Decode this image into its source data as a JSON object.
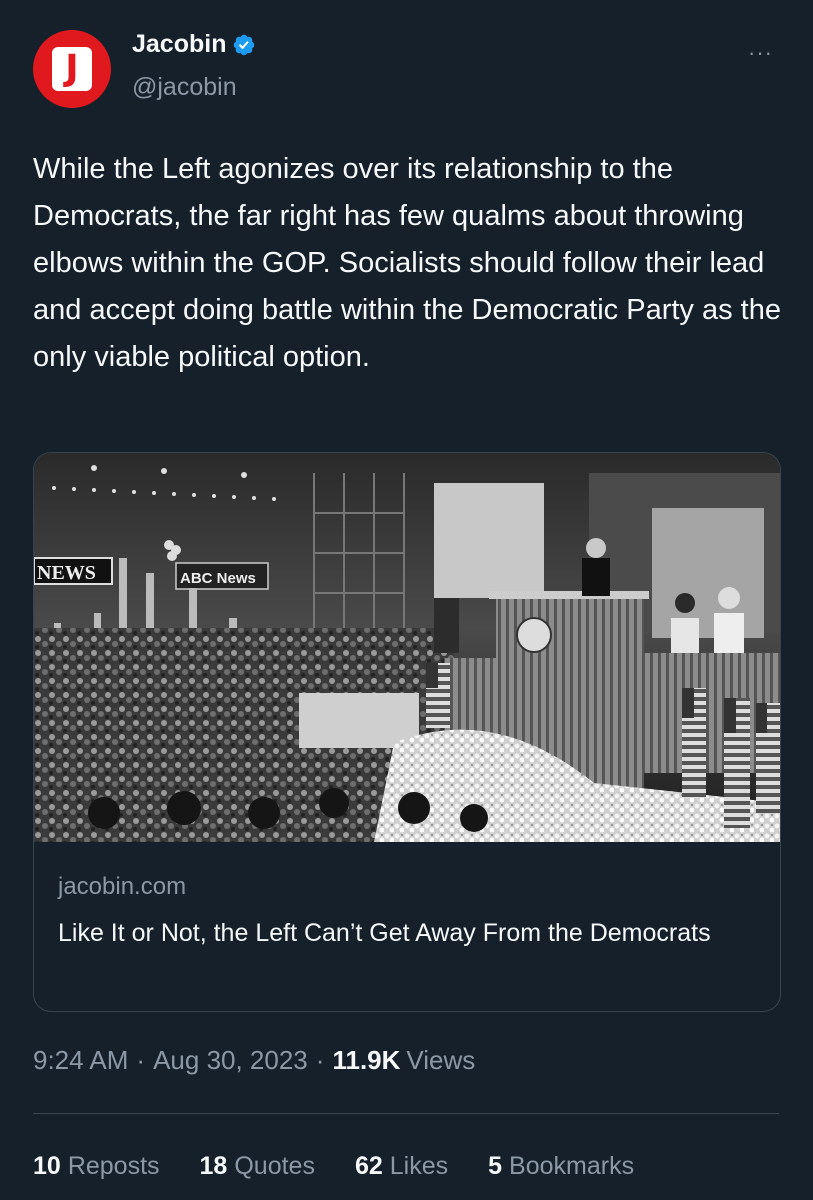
{
  "author": {
    "avatar_letter": "J",
    "name": "Jacobin",
    "handle": "@jacobin",
    "verified": true,
    "avatar_color": "#e0191e",
    "verified_color": "#1d9bf0"
  },
  "more_label": "···",
  "tweet": {
    "text": "While the Left agonizes over its relationship to the Democrats, the far right has few qualms about throwing elbows within the GOP. Socialists should follow their lead and accept doing battle within the Democratic Party as the only viable political option."
  },
  "card": {
    "image_signs": [
      "NEWS",
      "ABC News"
    ],
    "domain": "jacobin.com",
    "title": "Like It or Not, the Left Can’t Get Away From the Democrats"
  },
  "meta": {
    "time": "9:24 AM",
    "separator": "·",
    "date": "Aug 30, 2023",
    "views_count": "11.9K",
    "views_label": "Views"
  },
  "stats": {
    "reposts_count": "10",
    "reposts_label": "Reposts",
    "quotes_count": "18",
    "quotes_label": "Quotes",
    "likes_count": "62",
    "likes_label": "Likes",
    "bookmarks_count": "5",
    "bookmarks_label": "Bookmarks"
  },
  "colors": {
    "background": "#15202b",
    "text_primary": "#f7f9f9",
    "text_secondary": "#8b98a5",
    "border": "#38444d"
  }
}
